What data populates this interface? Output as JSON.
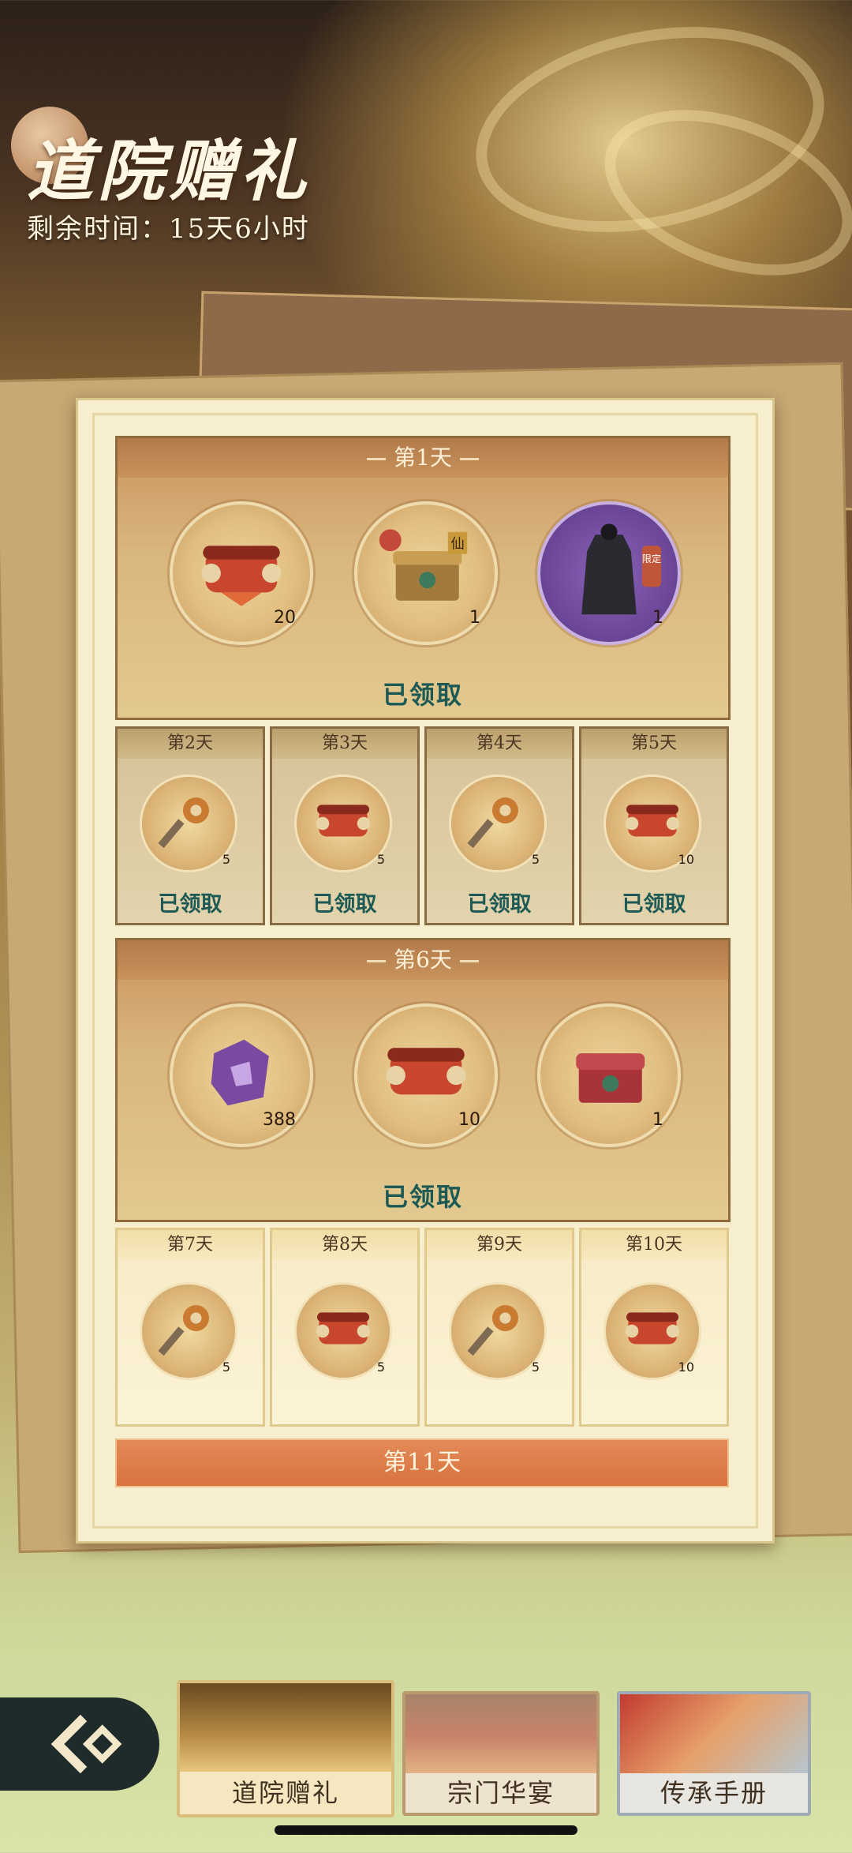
{
  "header": {
    "title": "道院赠礼",
    "remaining": "剩余时间：15天6小时"
  },
  "claimed_label": "已领取",
  "day1": {
    "label": "第1天",
    "items": [
      {
        "icon": "scroll-bundle-icon",
        "qty": "20"
      },
      {
        "icon": "treasure-chest-icon",
        "qty": "1",
        "tag": "仙"
      },
      {
        "icon": "robe-outfit-icon",
        "qty": "1",
        "tag": "限定"
      }
    ]
  },
  "days_row1": [
    {
      "label": "第2天",
      "icon": "key-icon",
      "qty": "5"
    },
    {
      "label": "第3天",
      "icon": "scroll-bundle-icon",
      "qty": "5"
    },
    {
      "label": "第4天",
      "icon": "key-icon",
      "qty": "5"
    },
    {
      "label": "第5天",
      "icon": "scroll-bundle-icon",
      "qty": "10"
    }
  ],
  "day6": {
    "label": "第6天",
    "items": [
      {
        "icon": "purple-jade-icon",
        "qty": "388"
      },
      {
        "icon": "scroll-bundle-icon",
        "qty": "10"
      },
      {
        "icon": "red-chest-icon",
        "qty": "1"
      }
    ]
  },
  "days_row2": [
    {
      "label": "第7天",
      "icon": "key-icon",
      "qty": "5"
    },
    {
      "label": "第8天",
      "icon": "scroll-bundle-icon",
      "qty": "5"
    },
    {
      "label": "第9天",
      "icon": "key-icon",
      "qty": "5"
    },
    {
      "label": "第10天",
      "icon": "scroll-bundle-icon",
      "qty": "10"
    }
  ],
  "day11": {
    "label": "第11天"
  },
  "tabs": [
    {
      "label": "道院赠礼"
    },
    {
      "label": "宗门华宴"
    },
    {
      "label": "传承手册"
    }
  ]
}
